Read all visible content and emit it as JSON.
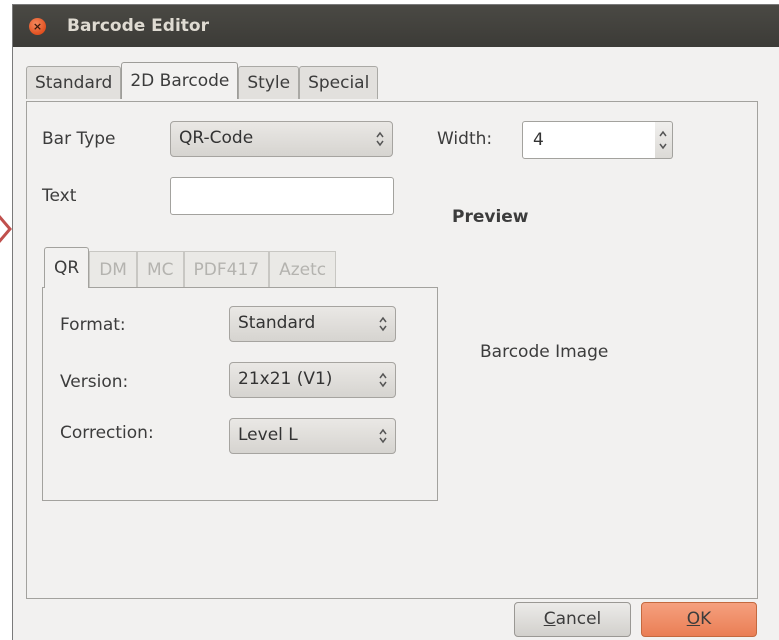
{
  "window": {
    "title": "Barcode Editor"
  },
  "tabs": [
    "Standard",
    "2D Barcode",
    "Style",
    "Special"
  ],
  "active_tab": "2D Barcode",
  "bar_type": {
    "label": "Bar Type",
    "value": "QR-Code"
  },
  "text_field": {
    "label": "Text",
    "value": ""
  },
  "width": {
    "label": "Width:",
    "value": "4"
  },
  "preview": {
    "heading": "Preview",
    "placeholder": "Barcode Image"
  },
  "inner_tabs": [
    "QR",
    "DM",
    "MC",
    "PDF417",
    "Azetc"
  ],
  "qr": {
    "format": {
      "label": "Format:",
      "value": "Standard"
    },
    "version": {
      "label": "Version:",
      "value": "21x21 (V1)"
    },
    "correction": {
      "label": "Correction:",
      "value": "Level L"
    }
  },
  "buttons": {
    "cancel": {
      "mnemonic": "C",
      "rest": "ancel"
    },
    "ok": {
      "mnemonic": "O",
      "rest": "K"
    }
  },
  "colors": {
    "titlebar": "#3c3b37",
    "accent": "#ea7e55",
    "close": "#e2501f"
  }
}
